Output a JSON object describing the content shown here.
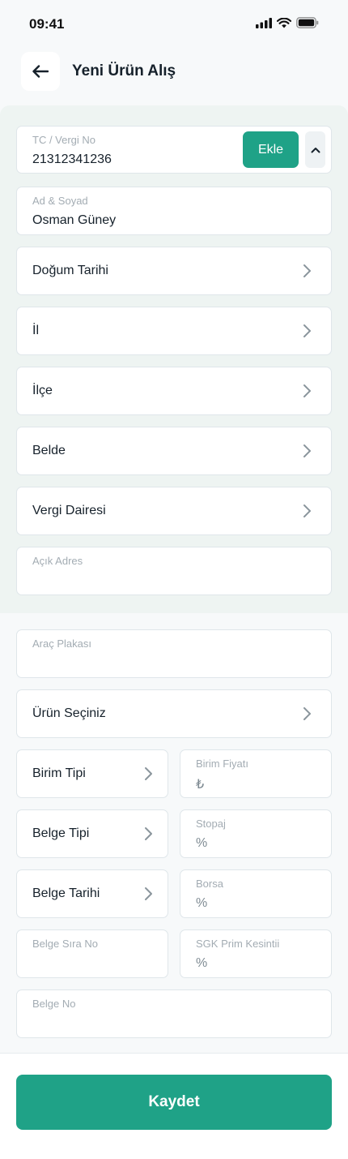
{
  "status": {
    "time": "09:41"
  },
  "header": {
    "title": "Yeni Ürün Alış"
  },
  "customer": {
    "tc": {
      "label": "TC / Vergi No",
      "value": "21312341236"
    },
    "add_label": "Ekle",
    "name": {
      "label": "Ad & Soyad",
      "value": "Osman Güney"
    },
    "birth_date": "Doğum Tarihi",
    "province": "İl",
    "district": "İlçe",
    "town": "Belde",
    "tax_office": "Vergi Dairesi",
    "address": {
      "label": "Açık Adres",
      "value": ""
    }
  },
  "product": {
    "plate": {
      "label": "Araç Plakası",
      "value": ""
    },
    "product_select": "Ürün Seçiniz",
    "unit_type": "Birim Tipi",
    "unit_price": {
      "label": "Birim Fiyatı",
      "value": "₺"
    },
    "doc_type": "Belge Tipi",
    "withholding": {
      "label": "Stopaj",
      "value": "%"
    },
    "doc_date": "Belge Tarihi",
    "exchange": {
      "label": "Borsa",
      "value": "%"
    },
    "doc_seq": {
      "label": "Belge Sıra No",
      "value": ""
    },
    "sgk": {
      "label": "SGK Prim Kesintii",
      "value": "%"
    },
    "doc_no": {
      "label": "Belge No",
      "value": ""
    }
  },
  "footer": {
    "save_label": "Kaydet"
  },
  "colors": {
    "accent": "#1fa287",
    "section_bg": "#eef4f2"
  }
}
